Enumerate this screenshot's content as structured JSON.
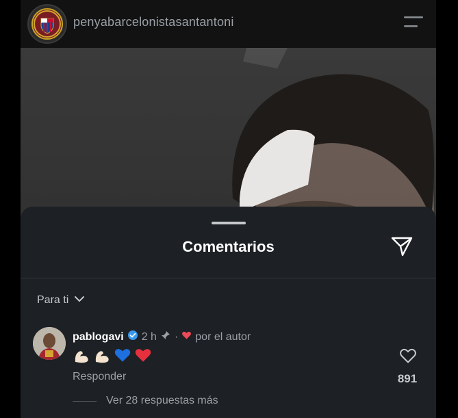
{
  "header": {
    "username": "penyabarcelonistasantantoni",
    "avatar_icon": "fc-barcelona-crest-icon",
    "menu_icon": "menu-icon"
  },
  "sheet": {
    "title": "Comentarios",
    "share_icon": "send-icon",
    "filter_label": "Para ti",
    "filter_icon": "chevron-down-icon"
  },
  "comment": {
    "username": "pablogavi",
    "verified_icon": "verified-badge-icon",
    "time": "2 h",
    "pin_icon": "pin-icon",
    "separator": "·",
    "heart_icon": "heart-icon",
    "liked_by_author": "por el autor",
    "emojis": [
      "flexed-biceps",
      "flexed-biceps",
      "blue-heart",
      "red-heart"
    ],
    "reply_label": "Responder",
    "like_count": "891",
    "view_replies": "Ver 28 respuestas más"
  },
  "colors": {
    "background": "#121212",
    "sheet": "#1d2125",
    "text_primary": "#ffffff",
    "text_secondary": "#9aa0a6",
    "verified": "#3897f0",
    "heart": "#ed4956"
  }
}
